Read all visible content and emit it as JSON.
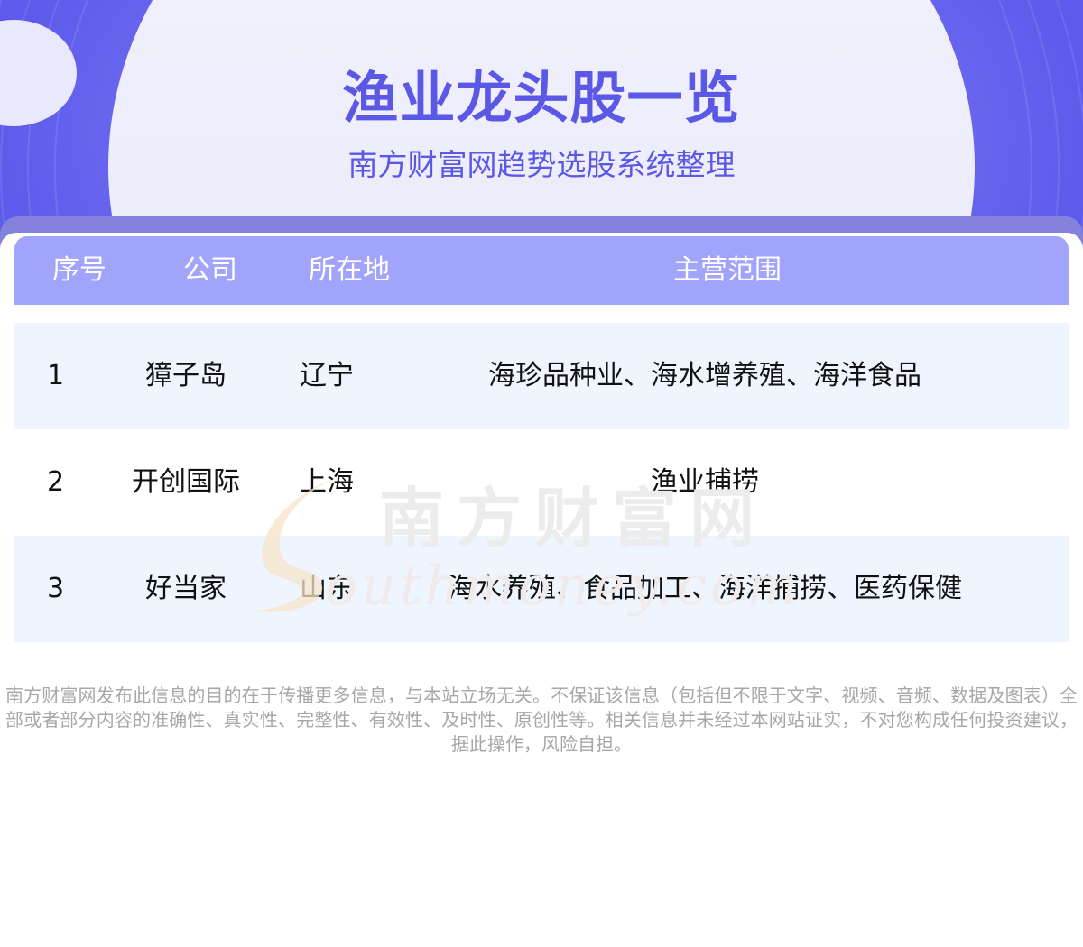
{
  "header": {
    "title": "渔业龙头股一览",
    "subtitle": "南方财富网趋势选股系统整理"
  },
  "table": {
    "columns": [
      "序号",
      "公司",
      "所在地",
      "主营范围"
    ],
    "rows": [
      {
        "no": "1",
        "company": "獐子岛",
        "location": "辽宁",
        "business": "海珍品种业、海水增养殖、海洋食品"
      },
      {
        "no": "2",
        "company": "开创国际",
        "location": "上海",
        "business": "渔业捕捞"
      },
      {
        "no": "3",
        "company": "好当家",
        "location": "山东",
        "business": "海水养殖、食品加工、海洋捕捞、医药保健"
      }
    ]
  },
  "watermark": {
    "cn": "南方财富网",
    "en": "Southmoney.com"
  },
  "disclaimer": "南方财富网发布此信息的目的在于传播更多信息，与本站立场无关。不保证该信息（包括但不限于文字、视频、音频、数据及图表）全部或者部分内容的准确性、真实性、完整性、有效性、及时性、原创性等。相关信息并未经过本网站证实，不对您构成任何投资建议，据此操作，风险自担。",
  "colors": {
    "brand": "#5b58e6",
    "header_row": "#a2a4fc",
    "row_shade": "#eef5fe",
    "banner": "#6f6cf0"
  }
}
